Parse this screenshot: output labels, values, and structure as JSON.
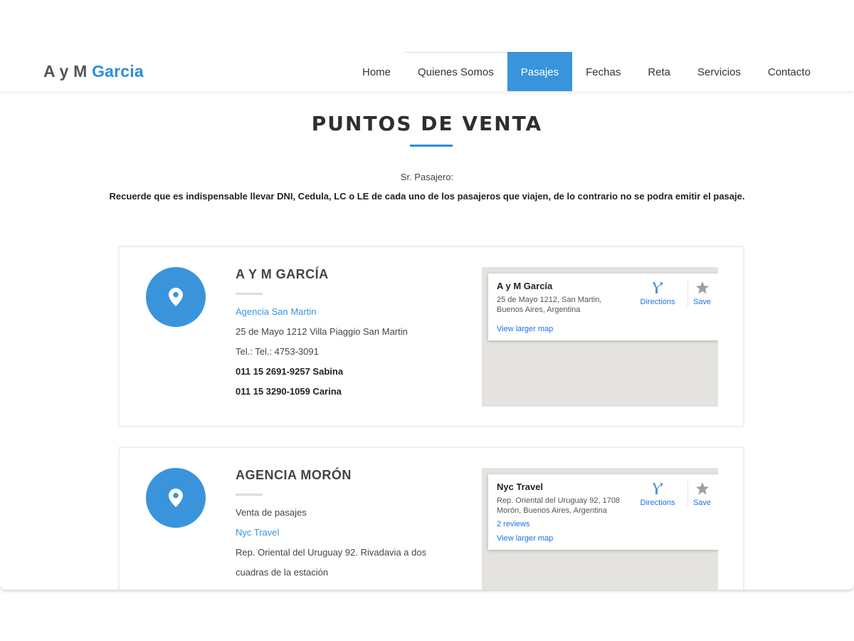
{
  "header": {
    "logo_plain": "A y M ",
    "logo_accent": "Garcia",
    "nav": [
      {
        "label": "Home"
      },
      {
        "label": "Quienes Somos"
      },
      {
        "label": "Pasajes"
      },
      {
        "label": "Fechas"
      },
      {
        "label": "Reta"
      },
      {
        "label": "Servicios"
      },
      {
        "label": "Contacto"
      }
    ],
    "active_nav": "Pasajes"
  },
  "main": {
    "title": "PUNTOS DE VENTA",
    "greeting": "Sr. Pasajero:",
    "notice": "Recuerde que es indispensable llevar DNI, Cedula, LC o LE de cada uno de los pasajeros que viajen, de lo contrario no se podra emitir el pasaje."
  },
  "cards": [
    {
      "title": "A Y M GARCÍA",
      "lines": [
        {
          "text": "Agencia San Martin",
          "style": "link"
        },
        {
          "text": "25 de Mayo 1212 Villa Piaggio San Martin",
          "style": "normal"
        },
        {
          "text": "Tel.: Tel.: 4753-3091",
          "style": "normal"
        },
        {
          "text": "011 15 2691-9257 Sabina",
          "style": "strong"
        },
        {
          "text": "011 15 3290-1059 Carina",
          "style": "strong"
        }
      ],
      "map": {
        "name": "A y M García",
        "address": "25 de Mayo 1212, San Martin, Buenos Aires, Argentina",
        "reviews": "",
        "directions_label": "Directions",
        "save_label": "Save",
        "larger_map_label": "View larger map"
      }
    },
    {
      "title": "AGENCIA MORÓN",
      "lines": [
        {
          "text": "Venta de pasajes",
          "style": "normal"
        },
        {
          "text": "Nyc Travel",
          "style": "link"
        },
        {
          "text": "Rep. Oriental del Uruguay 92. Rivadavia a dos",
          "style": "normal"
        },
        {
          "text": "cuadras de la estación",
          "style": "normal"
        }
      ],
      "map": {
        "name": "Nyc Travel",
        "address": "Rep. Oriental del Uruguay 92, 1708 Morón, Buenos Aires, Argentina",
        "reviews": "2 reviews",
        "directions_label": "Directions",
        "save_label": "Save",
        "larger_map_label": "View larger map"
      }
    }
  ],
  "colors": {
    "accent": "#3a94dc",
    "logo_accent": "#2b8fd6",
    "map_link": "#1a73e8",
    "map_background": "#e5e3df"
  },
  "icons": {
    "card_icon": "map-pin-icon",
    "directions_icon": "directions-arrow-icon",
    "save_icon": "star-icon"
  }
}
